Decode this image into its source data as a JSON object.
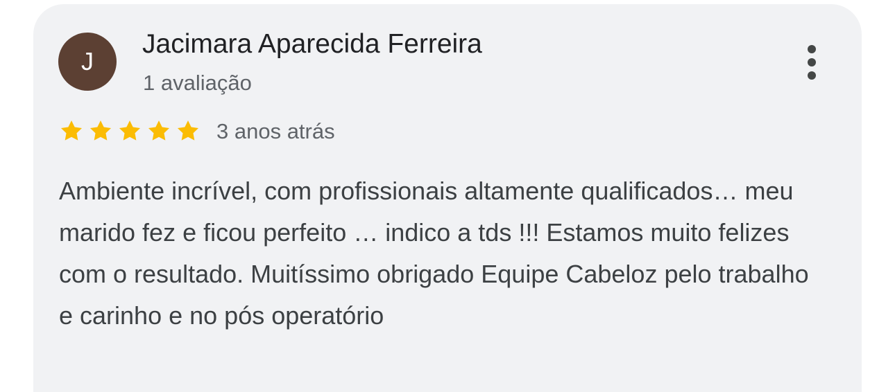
{
  "review": {
    "avatar_letter": "J",
    "avatar_color": "#5c4033",
    "author_name": "Jacimara Aparecida Ferreira",
    "review_count": "1 avaliação",
    "rating": 5,
    "rating_max": 5,
    "star_color": "#fbbc04",
    "date": "3 anos atrás",
    "text": "Ambiente incrível, com profissionais altamente qualificados… meu marido fez e ficou perfeito … indico a tds !!! Estamos muito felizes com o resultado. Muitíssimo obrigado Equipe Cabeloz pelo trabalho e carinho e no pós operatório",
    "more_icon": "more-vert-icon"
  }
}
